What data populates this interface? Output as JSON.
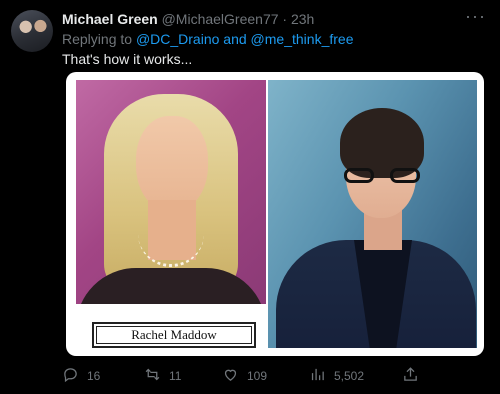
{
  "tweet": {
    "author_name": "Michael Green",
    "handle": "@MichaelGreen77",
    "separator": " · ",
    "time": "23h",
    "more_icon": "more-horizontal-icon",
    "replying_prefix": "Replying to ",
    "replying_user1": "@DC_Draino",
    "replying_and": " and ",
    "replying_user2": "@me_think_free",
    "text": "That's how it works..."
  },
  "media": {
    "left_caption": "Rachel Maddow"
  },
  "actions": {
    "reply_count": "16",
    "retweet_count": "11",
    "like_count": "109",
    "views_count": "5,502",
    "icons": [
      "reply-icon",
      "retweet-icon",
      "like-icon",
      "views-icon",
      "share-icon"
    ]
  },
  "colors": {
    "background": "#000000",
    "text": "#e7e9ea",
    "muted": "#71767b",
    "link": "#1d9bf0"
  }
}
